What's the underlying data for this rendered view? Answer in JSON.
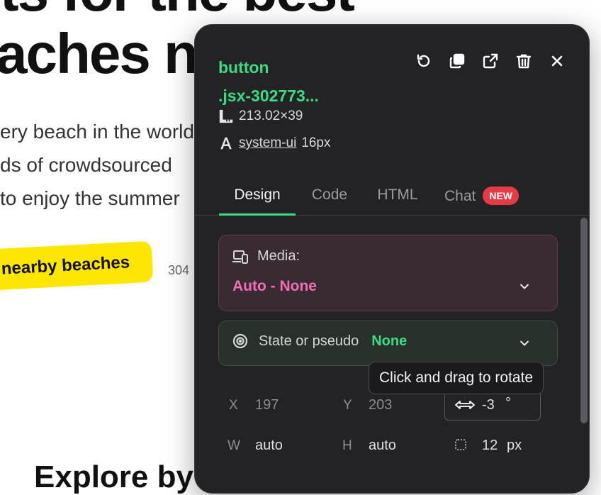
{
  "background": {
    "headline_top": "ts for the best",
    "headline": "aches near you",
    "paragraph": [
      "ery beach in the world",
      "ds of crowdsourced",
      " to enjoy the summer"
    ],
    "cta_label": "nearby beaches",
    "count_text": "304",
    "footer_heading": "Explore by"
  },
  "inspector": {
    "element_tag": "button",
    "element_class": ".jsx-302773...",
    "toolbar": [
      {
        "icon": "undo-icon",
        "label": "Reset"
      },
      {
        "icon": "copy-icon",
        "label": "Copy"
      },
      {
        "icon": "external-link-icon",
        "label": "Open"
      },
      {
        "icon": "trash-icon",
        "label": "Delete"
      },
      {
        "icon": "close-icon",
        "label": "Close"
      }
    ],
    "dimensions": "213.02×39",
    "font_family": "system-ui",
    "font_size": "16px",
    "tabs": [
      {
        "label": "Design",
        "active": true
      },
      {
        "label": "Code",
        "active": false
      },
      {
        "label": "HTML",
        "active": false
      },
      {
        "label": "Chat",
        "active": false,
        "badge": "NEW"
      }
    ],
    "media": {
      "label": "Media:",
      "value": "Auto - None"
    },
    "state": {
      "label": "State or pseudo",
      "value": "None"
    },
    "tooltip": "Click and drag to rotate",
    "props": {
      "x_label": "X",
      "x_value": "197",
      "y_label": "Y",
      "y_value": "203",
      "rotation_value": "-3",
      "rotation_unit": "°",
      "w_label": "W",
      "w_value": "auto",
      "h_label": "H",
      "h_value": "auto",
      "radius_value": "12",
      "radius_unit": "px"
    }
  },
  "colors": {
    "accent_green": "#3ddc84",
    "media_pink": "#f06fb5",
    "badge_red": "#e53b46",
    "cta_yellow": "#ffe600",
    "panel_bg": "#232326"
  }
}
